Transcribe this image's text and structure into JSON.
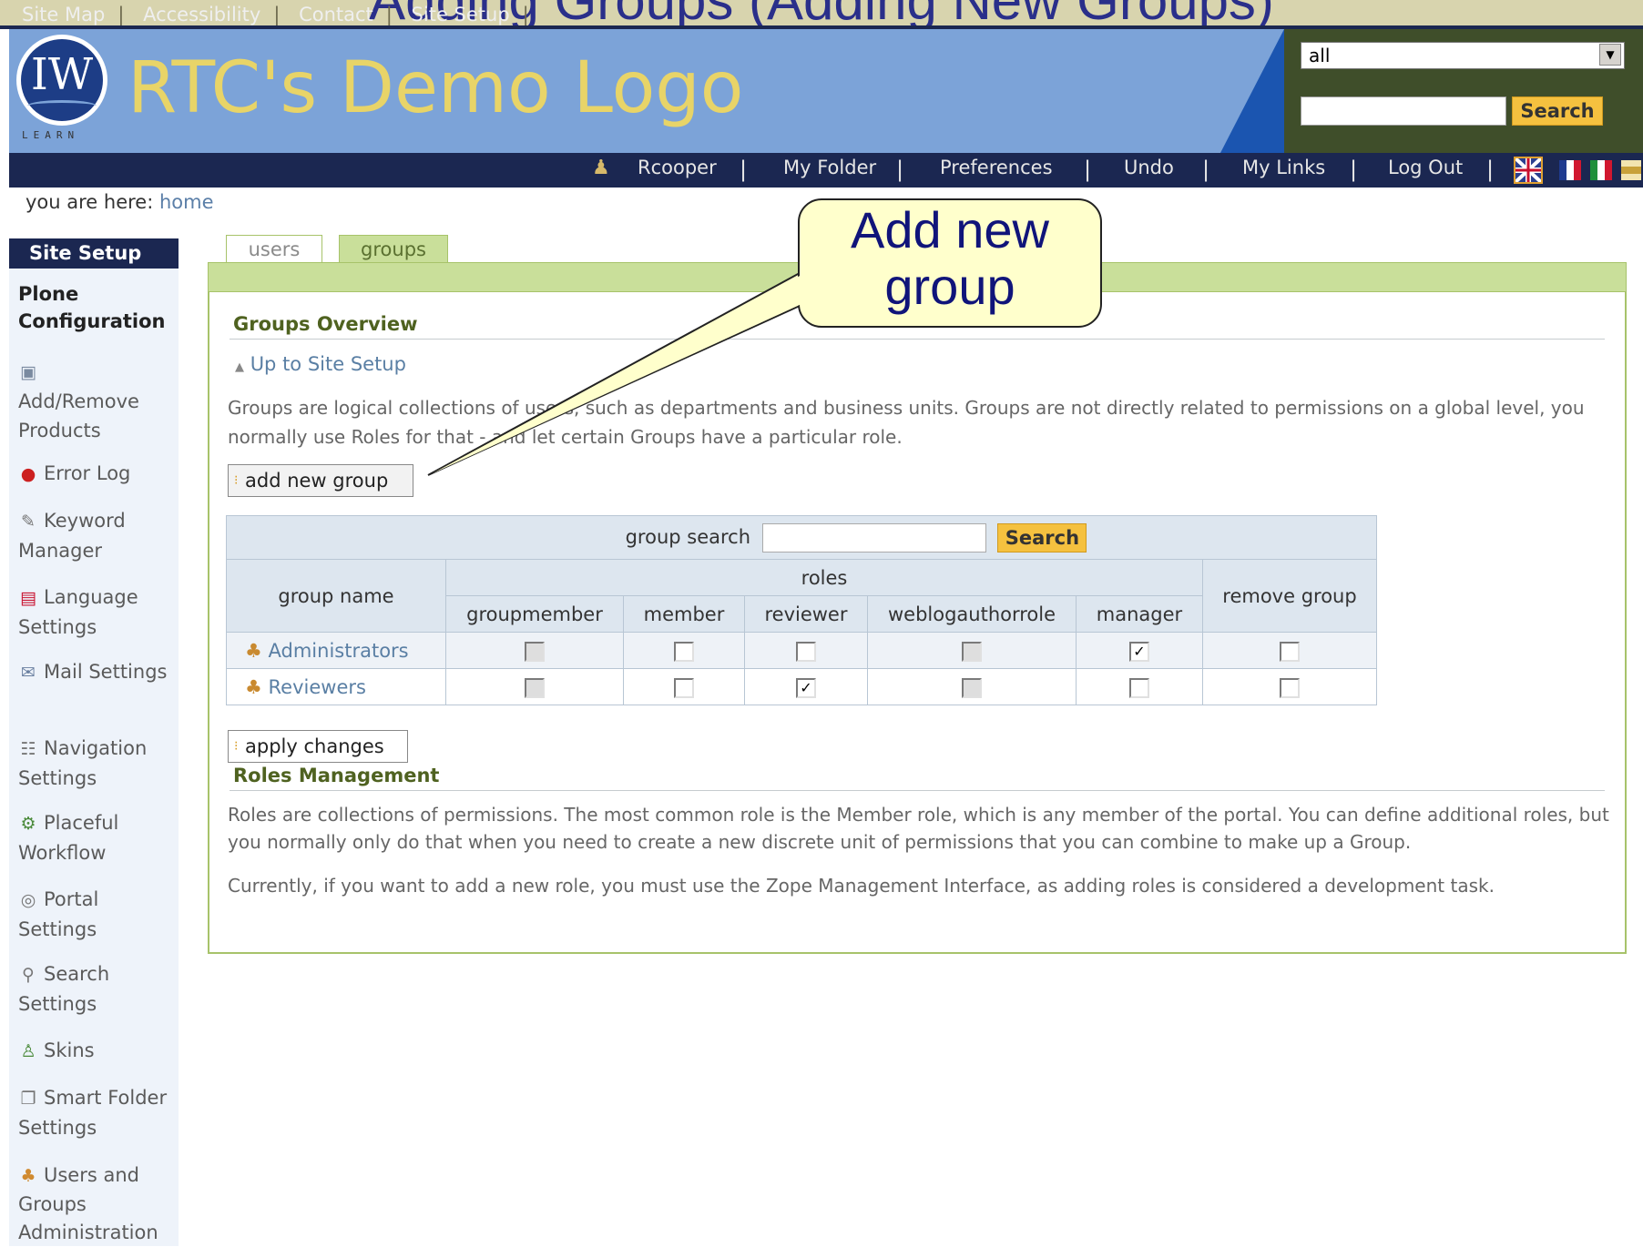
{
  "slide_title": "Adding Groups (Adding New Groups)",
  "site_links": [
    "Site Map",
    "Accessibility",
    "Contact",
    "Site Setup"
  ],
  "logo": {
    "monogram": "IW",
    "tagline": "LEARN"
  },
  "brand": "RTC's Demo Logo",
  "search": {
    "scope_value": "all",
    "input_value": "",
    "button_label": "Search"
  },
  "nav": {
    "user": "Rcooper",
    "items": [
      "My Folder",
      "Preferences",
      "Undo",
      "My Links",
      "Log Out"
    ],
    "flags": [
      "en-flag-icon",
      "fr-flag-icon",
      "it-flag-icon",
      "other-flag-icon"
    ]
  },
  "breadcrumb": {
    "prefix": "you are here:",
    "home": "home"
  },
  "sidebar": {
    "title": "Site Setup",
    "section": "Plone Configuration",
    "items": [
      {
        "label": "Add/Remove Products",
        "icon": "products-icon"
      },
      {
        "label": "Error Log",
        "icon": "error-icon"
      },
      {
        "label": "Keyword Manager",
        "icon": "keyword-icon"
      },
      {
        "label": "Language Settings",
        "icon": "language-icon"
      },
      {
        "label": "Mail Settings",
        "icon": "mail-icon"
      },
      {
        "label": "Navigation Settings",
        "icon": "navigation-icon"
      },
      {
        "label": "Placeful Workflow",
        "icon": "workflow-icon"
      },
      {
        "label": "Portal Settings",
        "icon": "portal-icon"
      },
      {
        "label": "Search Settings",
        "icon": "search-icon"
      },
      {
        "label": "Skins",
        "icon": "skins-icon"
      },
      {
        "label": "Smart Folder Settings",
        "icon": "smart-folder-icon"
      },
      {
        "label": "Users and Groups Administration",
        "icon": "users-groups-icon"
      }
    ]
  },
  "tabs": [
    {
      "label": "users",
      "active": false
    },
    {
      "label": "groups",
      "active": true
    }
  ],
  "groups_overview": {
    "heading": "Groups Overview",
    "up_link": "Up to Site Setup",
    "intro": "Groups are logical collections of users, such as departments and business units. Groups are not directly related to permissions on a global level, you normally use Roles for that - and let certain Groups have a particular role.",
    "add_button": "add new group"
  },
  "table": {
    "search_label": "group search",
    "search_value": "",
    "search_button": "Search",
    "group_name_header": "group name",
    "roles_header": "roles",
    "remove_header": "remove group",
    "role_columns": [
      "groupmember",
      "member",
      "reviewer",
      "weblogauthorrole",
      "manager"
    ],
    "rows": [
      {
        "name": "Administrators",
        "roles": [
          false,
          false,
          false,
          false,
          true
        ],
        "disabled": [
          true,
          false,
          false,
          true,
          false
        ],
        "remove": false
      },
      {
        "name": "Reviewers",
        "roles": [
          false,
          false,
          true,
          false,
          false
        ],
        "disabled": [
          true,
          false,
          false,
          true,
          false
        ],
        "remove": false
      }
    ]
  },
  "apply_button": "apply changes",
  "roles_management": {
    "heading": "Roles Management",
    "text1": "Roles are collections of permissions. The most common role is the Member role, which is any member of the portal. You can define additional roles, but you normally only do that when you need to create a new discrete unit of permissions that you can combine to make up a Group.",
    "text2": "Currently, if you want to add a new role, you must use the Zope Management Interface, as adding roles is considered a development task."
  },
  "callout": {
    "line1": "Add new",
    "line2": "group"
  },
  "colors": {
    "header_blue": "#7ca3d8",
    "nav_dark": "#1b2751",
    "tab_green": "#c9df9a",
    "search_orange": "#f5c13f",
    "callout_yellow": "#ffffcc"
  }
}
